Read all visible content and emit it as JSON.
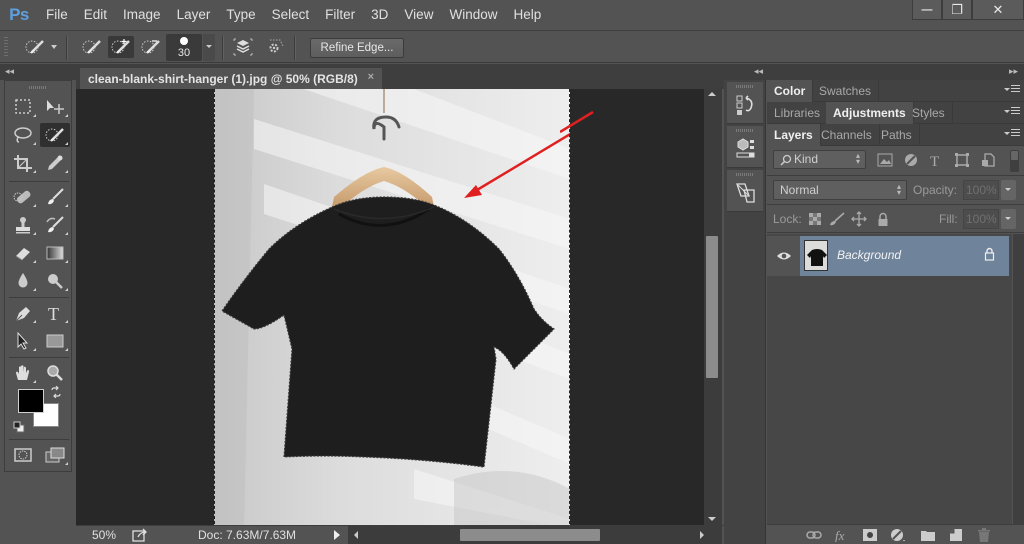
{
  "app": {
    "logo": "Ps",
    "menu": [
      "File",
      "Edit",
      "Image",
      "Layer",
      "Type",
      "Select",
      "Filter",
      "3D",
      "View",
      "Window",
      "Help"
    ],
    "window_controls": {
      "minimize": "—",
      "restore": "❐",
      "close": "✕"
    }
  },
  "options_bar": {
    "brush_size": "30",
    "refine_edge_label": "Refine Edge..."
  },
  "document": {
    "tab_title": "clean-blank-shirt-hanger (1).jpg @ 50% (RGB/8)",
    "tab_close": "×",
    "image_subject": "black t-shirt on wooden hanger with selection outline",
    "annotation_arrow_color": "#e02020"
  },
  "status": {
    "zoom": "50%",
    "doc_size": "Doc: 7.63M/7.63M"
  },
  "colors": {
    "foreground": "#000000",
    "background": "#ffffff",
    "selected_layer": "#6f839b"
  },
  "panels": {
    "group1": {
      "tabs": [
        "Color",
        "Swatches"
      ],
      "active": "Color"
    },
    "group2": {
      "tabs": [
        "Libraries",
        "Adjustments",
        "Styles"
      ],
      "active": "Adjustments"
    },
    "group3": {
      "tabs": [
        "Layers",
        "Channels",
        "Paths"
      ],
      "active": "Layers"
    }
  },
  "layers": {
    "filter_kind": "Kind",
    "blend_mode": "Normal",
    "opacity_label": "Opacity:",
    "opacity_value": "100%",
    "lock_label": "Lock:",
    "fill_label": "Fill:",
    "fill_value": "100%",
    "items": [
      {
        "name": "Background",
        "visible": true,
        "locked": true,
        "selected": true
      }
    ]
  }
}
